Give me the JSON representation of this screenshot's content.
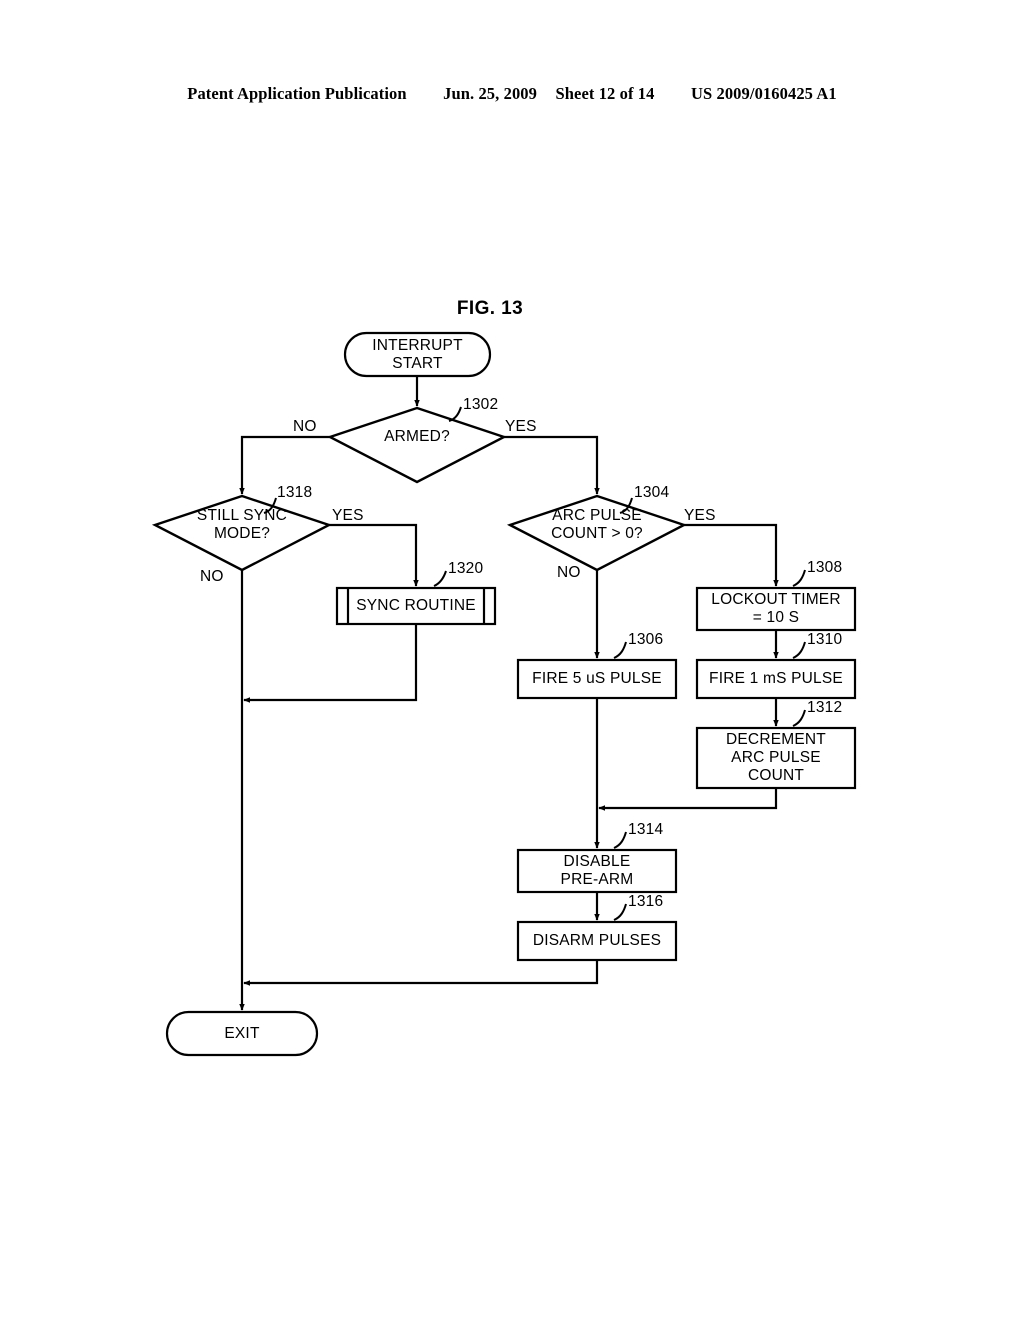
{
  "header": {
    "publication": "Patent Application Publication",
    "date": "Jun. 25, 2009",
    "sheet": "Sheet 12 of 14",
    "patent_number": "US 2009/0160425 A1"
  },
  "figure": {
    "title": "FIG. 13"
  },
  "nodes": {
    "start": {
      "label": "INTERRUPT\nSTART",
      "shape": "terminal"
    },
    "armed": {
      "label": "ARMED?",
      "ref": "1302",
      "shape": "decision"
    },
    "still_sync": {
      "label": "STILL SYNC\nMODE?",
      "ref": "1318",
      "shape": "decision"
    },
    "sync_routine": {
      "label": "SYNC ROUTINE",
      "ref": "1320",
      "shape": "predefined-process"
    },
    "arc_pulse": {
      "label": "ARC PULSE\nCOUNT > 0?",
      "ref": "1304",
      "shape": "decision"
    },
    "lockout_timer": {
      "label": "LOCKOUT TIMER\n= 10 S",
      "ref": "1308",
      "shape": "process"
    },
    "fire_5us": {
      "label": "FIRE 5 uS PULSE",
      "ref": "1306",
      "shape": "process"
    },
    "fire_1ms": {
      "label": "FIRE 1 mS PULSE",
      "ref": "1310",
      "shape": "process"
    },
    "decrement": {
      "label": "DECREMENT\nARC PULSE\nCOUNT",
      "ref": "1312",
      "shape": "process"
    },
    "disable_prearm": {
      "label": "DISABLE\nPRE-ARM",
      "ref": "1314",
      "shape": "process"
    },
    "disarm_pulses": {
      "label": "DISARM PULSES",
      "ref": "1316",
      "shape": "process"
    },
    "exit": {
      "label": "EXIT",
      "shape": "terminal"
    }
  },
  "edge_labels": {
    "armed_no": "NO",
    "armed_yes": "YES",
    "still_sync_yes": "YES",
    "still_sync_no": "NO",
    "arc_pulse_yes": "YES",
    "arc_pulse_no": "NO"
  },
  "colors": {
    "ink": "#000000",
    "paper": "#ffffff"
  }
}
